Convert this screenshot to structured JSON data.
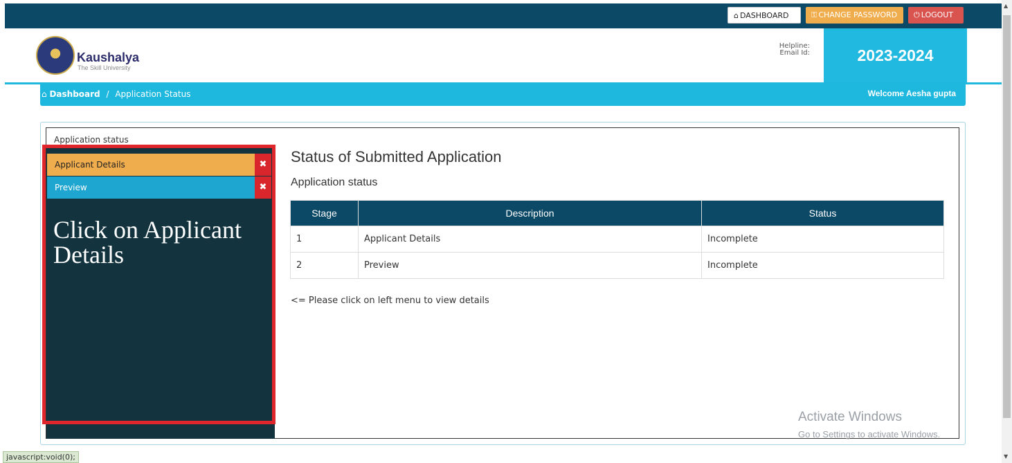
{
  "topbar": {
    "dashboard_label": "DASHBOARD",
    "change_password_label": "CHANGE PASSWORD",
    "logout_label": "LOGOUT"
  },
  "header": {
    "logo_title": "Kaushalya",
    "logo_subtitle": "The Skill University",
    "helpline_label": "Helpline:",
    "email_label": "Email Id:",
    "year": "2023-2024"
  },
  "breadcrumb": {
    "home": "Dashboard",
    "separator": "/",
    "current": "Application Status",
    "welcome": "Welcome Aesha gupta"
  },
  "panel": {
    "label": "Application status"
  },
  "sidebar": {
    "items": [
      {
        "label": "Applicant Details",
        "close": "✖"
      },
      {
        "label": "Preview",
        "close": "✖"
      }
    ],
    "annotation": "Click on Applicant Details"
  },
  "main": {
    "title": "Status of Submitted Application",
    "subtitle": "Application status",
    "table": {
      "headers": [
        "Stage",
        "Description",
        "Status"
      ],
      "rows": [
        [
          "1",
          "Applicant Details",
          "Incomplete"
        ],
        [
          "2",
          "Preview",
          "Incomplete"
        ]
      ]
    },
    "hint": "<= Please click on left menu to view details"
  },
  "watermark": {
    "line1": "Activate Windows",
    "line2": "Go to Settings to activate Windows."
  },
  "statusbar": "javascript:void(0);",
  "colors": {
    "navy": "#0b4966",
    "cyan": "#1eb8df",
    "orange": "#f0ad4e",
    "red": "#d9534f",
    "sidebar": "#13343f",
    "highlight": "#e0262d"
  }
}
